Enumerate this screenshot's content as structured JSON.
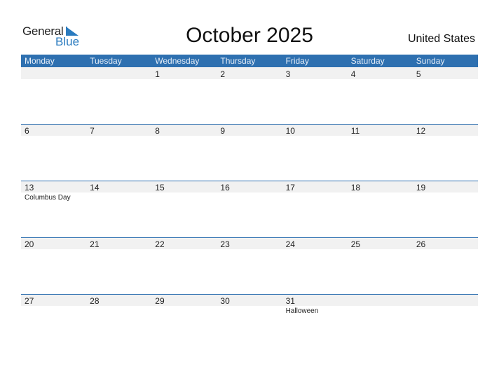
{
  "logo": {
    "general": "General",
    "blue": "Blue"
  },
  "title": "October 2025",
  "country": "United States",
  "colors": {
    "accent": "#2e70b0",
    "band": "#f1f1f1"
  },
  "weekdays": [
    "Monday",
    "Tuesday",
    "Wednesday",
    "Thursday",
    "Friday",
    "Saturday",
    "Sunday"
  ],
  "weeks": [
    {
      "days": [
        {
          "num": ""
        },
        {
          "num": ""
        },
        {
          "num": "1"
        },
        {
          "num": "2"
        },
        {
          "num": "3"
        },
        {
          "num": "4"
        },
        {
          "num": "5"
        }
      ]
    },
    {
      "days": [
        {
          "num": "6"
        },
        {
          "num": "7"
        },
        {
          "num": "8"
        },
        {
          "num": "9"
        },
        {
          "num": "10"
        },
        {
          "num": "11"
        },
        {
          "num": "12"
        }
      ]
    },
    {
      "days": [
        {
          "num": "13",
          "holiday": "Columbus Day"
        },
        {
          "num": "14"
        },
        {
          "num": "15"
        },
        {
          "num": "16"
        },
        {
          "num": "17"
        },
        {
          "num": "18"
        },
        {
          "num": "19"
        }
      ]
    },
    {
      "days": [
        {
          "num": "20"
        },
        {
          "num": "21"
        },
        {
          "num": "22"
        },
        {
          "num": "23"
        },
        {
          "num": "24"
        },
        {
          "num": "25"
        },
        {
          "num": "26"
        }
      ]
    },
    {
      "days": [
        {
          "num": "27"
        },
        {
          "num": "28"
        },
        {
          "num": "29"
        },
        {
          "num": "30"
        },
        {
          "num": "31",
          "holiday": "Halloween"
        },
        {
          "num": ""
        },
        {
          "num": ""
        }
      ]
    }
  ]
}
